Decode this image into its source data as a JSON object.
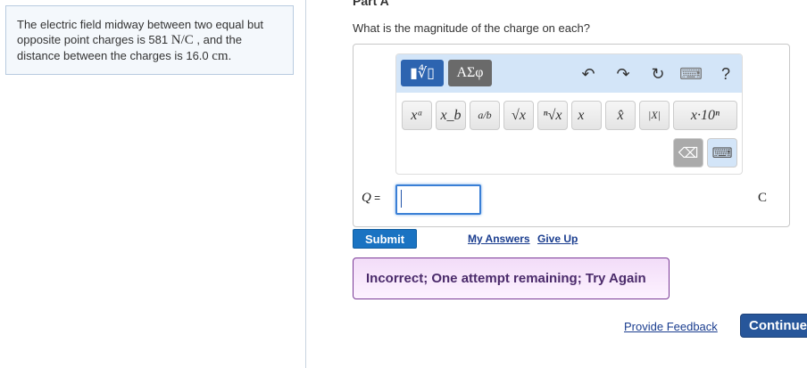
{
  "problem": {
    "text_before": "The electric field midway between two equal but opposite point charges is 581 ",
    "field_unit": "N/C",
    "text_mid": " , and the distance between the charges is 16.0 ",
    "dist_unit": "cm",
    "text_end": "."
  },
  "part": {
    "title": "Part A",
    "question": "What is the magnitude of the charge on each?"
  },
  "toolbar": {
    "templates_tab": "▮∜▯",
    "symbols_tab": "ΑΣφ",
    "undo": "↶",
    "redo": "↷",
    "reset": "↻",
    "keyboard": "⌨",
    "help": "?",
    "keys": [
      "xᵃ",
      "x_b",
      "a/b",
      "√x",
      "ⁿ√x",
      "x⃗",
      "x̂",
      "|X|",
      "x·10ⁿ"
    ],
    "backspace": "⌫",
    "keyboard_toggle": "⌨"
  },
  "answer": {
    "label": "Q",
    "equals": " =",
    "value": "",
    "unit": "C"
  },
  "actions": {
    "submit": "Submit",
    "my_answers": "My Answers",
    "give_up": "Give Up"
  },
  "feedback": "Incorrect; One attempt remaining; Try Again",
  "footer": {
    "provide_feedback": "Provide Feedback",
    "continue": "Continue"
  }
}
